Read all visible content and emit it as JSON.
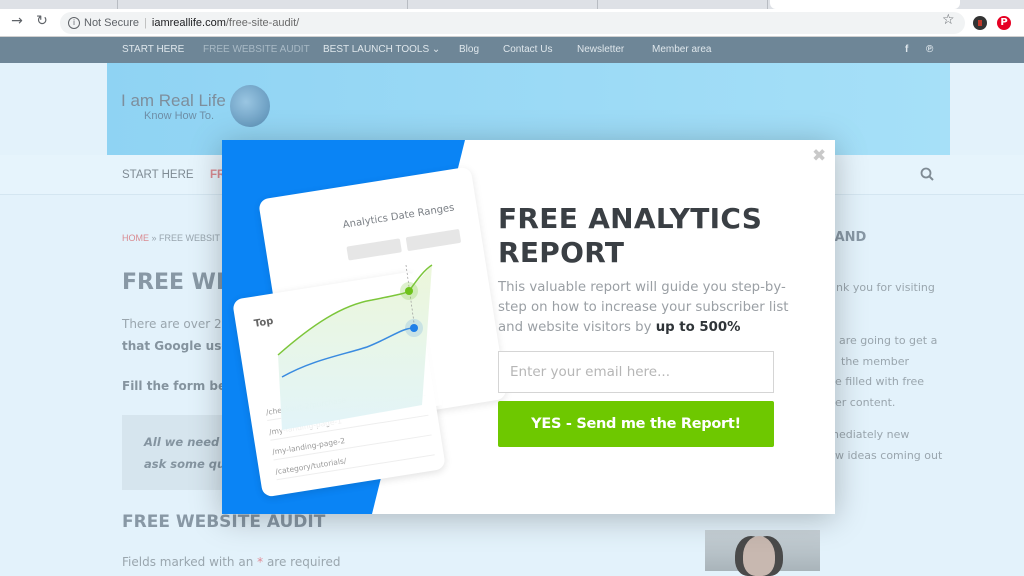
{
  "browser": {
    "security_label": "Not Secure",
    "url_domain": "iamreallife.com",
    "url_path": "/free-site-audit/"
  },
  "top_nav": {
    "items": [
      "START HERE",
      "FREE WEBSITE AUDIT",
      "BEST LAUNCH TOOLS ⌄",
      "Blog",
      "Contact Us",
      "Newsletter",
      "Member area"
    ],
    "social": [
      "f",
      "℗"
    ]
  },
  "site": {
    "logo_line1": "I am Real Life",
    "logo_line2": "Know How To."
  },
  "main_nav": {
    "items": [
      "START HERE",
      "FR"
    ]
  },
  "page": {
    "breadcrumb_home": "HOME",
    "breadcrumb_sep": "»",
    "breadcrumb_current": "FREE WEBSIT",
    "title": "FREE WE",
    "intro_line1": "There are over 20",
    "intro_line2": "that Google uses",
    "fill_form": "Fill the form bel",
    "quote_line1": "All we need is",
    "quote_line2": "ask some que",
    "section_title": "FREE WEBSITE AUDIT",
    "required_prefix": "Fields marked with an ",
    "required_asterisk": "*",
    "required_suffix": " are required"
  },
  "sidebar": {
    "heading": "K AND",
    "lines": [
      "nk you for visiting",
      "are going to get a",
      "the member",
      "e filled with free",
      "er content.",
      "nediately new",
      "w ideas coming out"
    ]
  },
  "modal": {
    "close_label": "✖",
    "title_line1": "FREE ANALYTICS",
    "title_line2": "REPORT",
    "desc_text": "This valuable report will guide you step-by-step on how to increase your subscriber list and website visitors by ",
    "desc_bold": "up to 500%",
    "email_placeholder": "Enter your email here...",
    "cta_label": "YES - Send me the Report!",
    "accent_blue": "#0a84f5",
    "accent_green": "#6ec800",
    "illustration": {
      "card_title": "Analytics Date Ranges",
      "list_title": "Top",
      "list_rows": [
        "/checkout-2/purchase",
        "/my-landing-page-1",
        "/my-landing-page-2",
        "/category/tutorials/"
      ]
    }
  }
}
